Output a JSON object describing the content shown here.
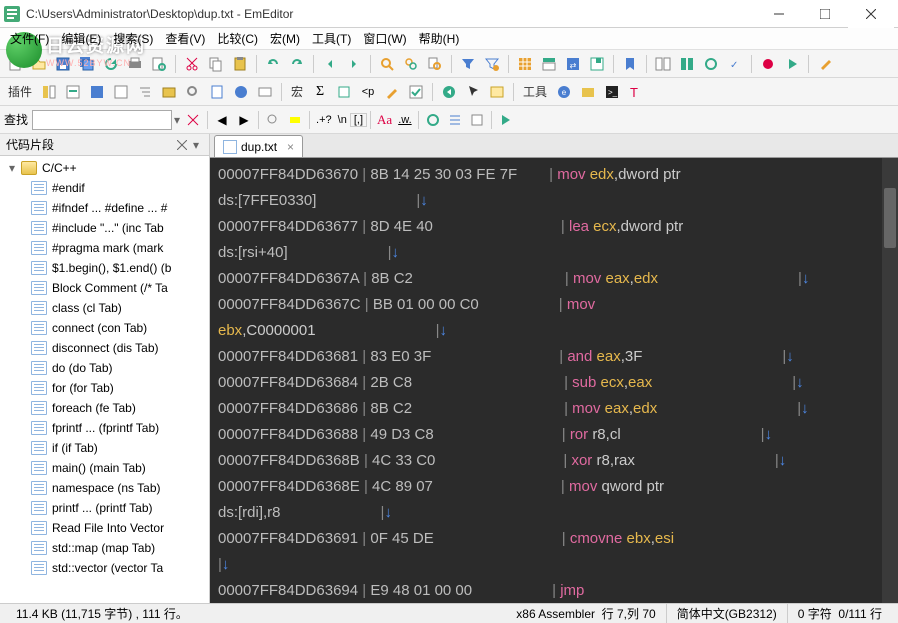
{
  "title": "C:\\Users\\Administrator\\Desktop\\dup.txt - EmEditor",
  "watermark": {
    "text": "日云资源网",
    "url": "WWW.52BYW.CN"
  },
  "menu": [
    {
      "label": "文件(F)"
    },
    {
      "label": "编辑(E)"
    },
    {
      "label": "搜索(S)"
    },
    {
      "label": "查看(V)"
    },
    {
      "label": "比较(C)"
    },
    {
      "label": "宏(M)"
    },
    {
      "label": "工具(T)"
    },
    {
      "label": "窗口(W)"
    },
    {
      "label": "帮助(H)"
    }
  ],
  "toolbar2": {
    "plugin": "插件",
    "macro": "宏",
    "tools": "工具"
  },
  "findLabel": "查找",
  "sidebar": {
    "title": "代码片段",
    "root": "C/C++",
    "items": [
      "#endif",
      "#ifndef ... #define ... #",
      "#include \"...\"  (inc Tab",
      "#pragma mark  (mark",
      "$1.begin(), $1.end()  (b",
      "Block Comment  (/* Ta",
      "class   (cl Tab)",
      "connect  (con Tab)",
      "disconnect  (dis Tab)",
      "do  (do Tab)",
      "for  (for Tab)",
      "foreach  (fe Tab)",
      "fprintf ...  (fprintf Tab)",
      "if  (if Tab)",
      "main()  (main Tab)",
      "namespace  (ns Tab)",
      "printf ...  (printf Tab)",
      "Read File Into Vector",
      "std::map  (map Tab)",
      "std::vector  (vector Ta"
    ]
  },
  "tab": "dup.txt",
  "code": [
    {
      "addr": "00007FF84DD63670",
      "hex": "8B 14 25 30 03 FE 7F",
      "instr": [
        {
          "t": "| ",
          "c": "pipe"
        },
        {
          "t": "mov ",
          "c": "op"
        },
        {
          "t": "edx",
          "c": "reg"
        },
        {
          "t": ",dword ptr",
          "c": ""
        }
      ]
    },
    {
      "addr": "ds:[7FFE0330]",
      "hex": "",
      "tail": "|",
      "arrow": "↓",
      "noaddr": true
    },
    {
      "addr": "00007FF84DD63677",
      "hex": "8D 4E 40",
      "instr": [
        {
          "t": "| ",
          "c": "pipe"
        },
        {
          "t": "lea ",
          "c": "op"
        },
        {
          "t": "ecx",
          "c": "reg"
        },
        {
          "t": ",dword ptr",
          "c": ""
        }
      ]
    },
    {
      "addr": "ds:[rsi+40]",
      "hex": "",
      "tail": "|",
      "arrow": "↓",
      "noaddr": true
    },
    {
      "addr": "00007FF84DD6367A",
      "hex": "8B C2",
      "instr": [
        {
          "t": "| ",
          "c": "pipe"
        },
        {
          "t": "mov ",
          "c": "op"
        },
        {
          "t": "eax",
          "c": "reg"
        },
        {
          "t": ",",
          "c": ""
        },
        {
          "t": "edx",
          "c": "reg"
        }
      ],
      "rarrow": "|↓"
    },
    {
      "addr": "00007FF84DD6367C",
      "hex": "BB 01 00 00 C0",
      "instr": [
        {
          "t": "| ",
          "c": "pipe"
        },
        {
          "t": "mov",
          "c": "op"
        }
      ]
    },
    {
      "addr": "",
      "hex": "",
      "prefix": [
        {
          "t": "ebx",
          "c": "reg"
        },
        {
          "t": ",C0000001",
          "c": ""
        }
      ],
      "tail": "|",
      "arrow": "↓"
    },
    {
      "addr": "00007FF84DD63681",
      "hex": "83 E0 3F",
      "instr": [
        {
          "t": "| ",
          "c": "pipe"
        },
        {
          "t": "and ",
          "c": "op"
        },
        {
          "t": "eax",
          "c": "reg"
        },
        {
          "t": ",3F",
          "c": ""
        }
      ],
      "rarrow": "|↓"
    },
    {
      "addr": "00007FF84DD63684",
      "hex": "2B C8",
      "instr": [
        {
          "t": "| ",
          "c": "pipe"
        },
        {
          "t": "sub ",
          "c": "op"
        },
        {
          "t": "ecx",
          "c": "reg"
        },
        {
          "t": ",",
          "c": ""
        },
        {
          "t": "eax",
          "c": "reg"
        }
      ],
      "rarrow": "|↓"
    },
    {
      "addr": "00007FF84DD63686",
      "hex": "8B C2",
      "instr": [
        {
          "t": "| ",
          "c": "pipe"
        },
        {
          "t": "mov ",
          "c": "op"
        },
        {
          "t": "eax",
          "c": "reg"
        },
        {
          "t": ",",
          "c": ""
        },
        {
          "t": "edx",
          "c": "reg"
        }
      ],
      "rarrow": "|↓"
    },
    {
      "addr": "00007FF84DD63688",
      "hex": "49 D3 C8",
      "instr": [
        {
          "t": "| ",
          "c": "pipe"
        },
        {
          "t": "ror ",
          "c": "op"
        },
        {
          "t": "r8,cl",
          "c": ""
        }
      ],
      "rarrow": "|↓"
    },
    {
      "addr": "00007FF84DD6368B",
      "hex": "4C 33 C0",
      "instr": [
        {
          "t": "| ",
          "c": "pipe"
        },
        {
          "t": "xor ",
          "c": "op"
        },
        {
          "t": "r8,rax",
          "c": ""
        }
      ],
      "rarrow": "|↓"
    },
    {
      "addr": "00007FF84DD6368E",
      "hex": "4C 89 07",
      "instr": [
        {
          "t": "| ",
          "c": "pipe"
        },
        {
          "t": "mov ",
          "c": "op"
        },
        {
          "t": "qword ptr",
          "c": ""
        }
      ]
    },
    {
      "addr": "ds:[rdi],r8",
      "hex": "",
      "tail": "|",
      "arrow": "↓",
      "noaddr": true
    },
    {
      "addr": "00007FF84DD63691",
      "hex": "0F 45 DE",
      "instr": [
        {
          "t": "| ",
          "c": "pipe"
        },
        {
          "t": "cmovne ",
          "c": "op"
        },
        {
          "t": "ebx",
          "c": "reg"
        },
        {
          "t": ",",
          "c": ""
        },
        {
          "t": "esi",
          "c": "reg"
        }
      ]
    },
    {
      "addr": "",
      "hex": "",
      "tail": "|",
      "arrow": "↓"
    },
    {
      "addr": "00007FF84DD63694",
      "hex": "E9 48 01 00 00",
      "instr": [
        {
          "t": "| ",
          "c": "pipe"
        },
        {
          "t": "jmp",
          "c": "op"
        }
      ]
    }
  ],
  "status": {
    "size": "11.4 KB (11,715 字节) , 111 行。",
    "lang": "x86 Assembler",
    "pos": "行 7,列 70",
    "enc": "简体中文(GB2312)",
    "sel": "0 字符",
    "lines": "0/111 行"
  }
}
